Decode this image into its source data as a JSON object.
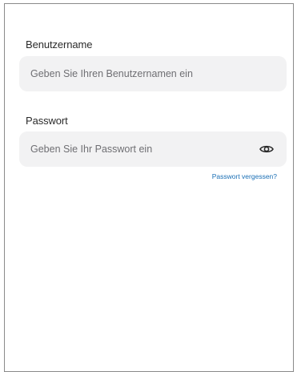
{
  "form": {
    "username": {
      "label": "Benutzername",
      "value": "",
      "placeholder": "Geben Sie Ihren Benutzernamen ein"
    },
    "password": {
      "label": "Passwort",
      "value": "",
      "placeholder": "Geben Sie Ihr Passwort ein",
      "toggle_icon": "eye-icon"
    },
    "forgot_password_link": "Passwort vergessen?"
  },
  "colors": {
    "input_background": "#f2f2f3",
    "link": "#1a6fb5",
    "frame_border": "#8a8a8a"
  }
}
